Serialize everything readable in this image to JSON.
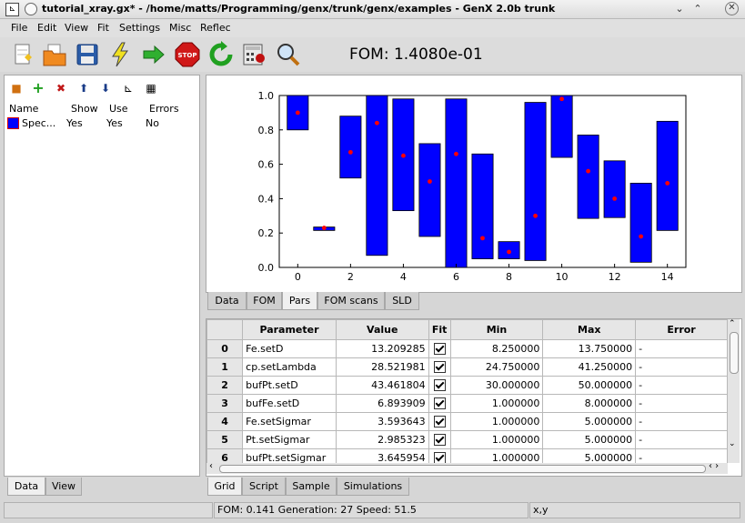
{
  "window": {
    "title": "tutorial_xray.gx* - /home/matts/Programming/genx/trunk/genx/examples - GenX 2.0b trunk"
  },
  "menu": [
    "File",
    "Edit",
    "View",
    "Fit",
    "Settings",
    "Misc",
    "Reflec"
  ],
  "toolbar": {
    "fom_label": "FOM: 1.4080e-01",
    "stop_label": "STOP"
  },
  "left_panel": {
    "columns": [
      "Name",
      "Show",
      "Use",
      "Errors"
    ],
    "rows": [
      {
        "name": "Spec...",
        "show": "Yes",
        "use": "Yes",
        "errors": "No"
      }
    ],
    "tabs": [
      "Data",
      "View"
    ],
    "active_tab": "Data"
  },
  "plot_tabs": [
    "Data",
    "FOM",
    "Pars",
    "FOM scans",
    "SLD"
  ],
  "active_plot_tab": "Pars",
  "chart_data": {
    "type": "bar",
    "x": [
      0,
      1,
      2,
      3,
      4,
      5,
      6,
      7,
      8,
      9,
      10,
      11,
      12,
      13,
      14
    ],
    "xticks": [
      "0",
      "2",
      "4",
      "6",
      "8",
      "10",
      "12",
      "14"
    ],
    "yticks": [
      "0.0",
      "0.2",
      "0.4",
      "0.6",
      "0.8",
      "1.0"
    ],
    "ylim": [
      0,
      1.0
    ],
    "xlim": [
      -0.7,
      14.7
    ],
    "bar_bottoms": [
      0.8,
      0.215,
      0.52,
      0.07,
      0.33,
      0.18,
      0.0,
      0.05,
      0.05,
      0.04,
      0.64,
      0.285,
      0.29,
      0.03,
      0.215
    ],
    "bar_tops": [
      1.0,
      0.235,
      0.88,
      1.0,
      0.98,
      0.72,
      0.98,
      0.66,
      0.15,
      0.96,
      1.0,
      0.77,
      0.62,
      0.49,
      0.85
    ],
    "values": [
      0.9,
      0.23,
      0.67,
      0.84,
      0.65,
      0.5,
      0.66,
      0.17,
      0.09,
      0.3,
      0.98,
      0.56,
      0.4,
      0.18,
      0.49
    ],
    "bar_color": "#0000ff",
    "marker_color": "#ff0000"
  },
  "grid": {
    "headers": [
      "Parameter",
      "Value",
      "Fit",
      "Min",
      "Max",
      "Error"
    ],
    "rows": [
      {
        "idx": "0",
        "param": "Fe.setD",
        "value": "13.209285",
        "min": "8.250000",
        "max": "13.750000",
        "error": "-"
      },
      {
        "idx": "1",
        "param": "cp.setLambda",
        "value": "28.521981",
        "min": "24.750000",
        "max": "41.250000",
        "error": "-"
      },
      {
        "idx": "2",
        "param": "bufPt.setD",
        "value": "43.461804",
        "min": "30.000000",
        "max": "50.000000",
        "error": "-"
      },
      {
        "idx": "3",
        "param": "bufFe.setD",
        "value": "6.893909",
        "min": "1.000000",
        "max": "8.000000",
        "error": "-"
      },
      {
        "idx": "4",
        "param": "Fe.setSigmar",
        "value": "3.593643",
        "min": "1.000000",
        "max": "5.000000",
        "error": "-"
      },
      {
        "idx": "5",
        "param": "Pt.setSigmar",
        "value": "2.985323",
        "min": "1.000000",
        "max": "5.000000",
        "error": "-"
      },
      {
        "idx": "6",
        "param": "bufPt.setSigmar",
        "value": "3.645954",
        "min": "1.000000",
        "max": "5.000000",
        "error": "-"
      }
    ]
  },
  "bottom_tabs": [
    "Grid",
    "Script",
    "Sample",
    "Simulations"
  ],
  "active_bottom_tab": "Grid",
  "status": {
    "fit_info": "FOM: 0.141 Generation: 27 Speed: 51.5",
    "coords": "x,y"
  }
}
